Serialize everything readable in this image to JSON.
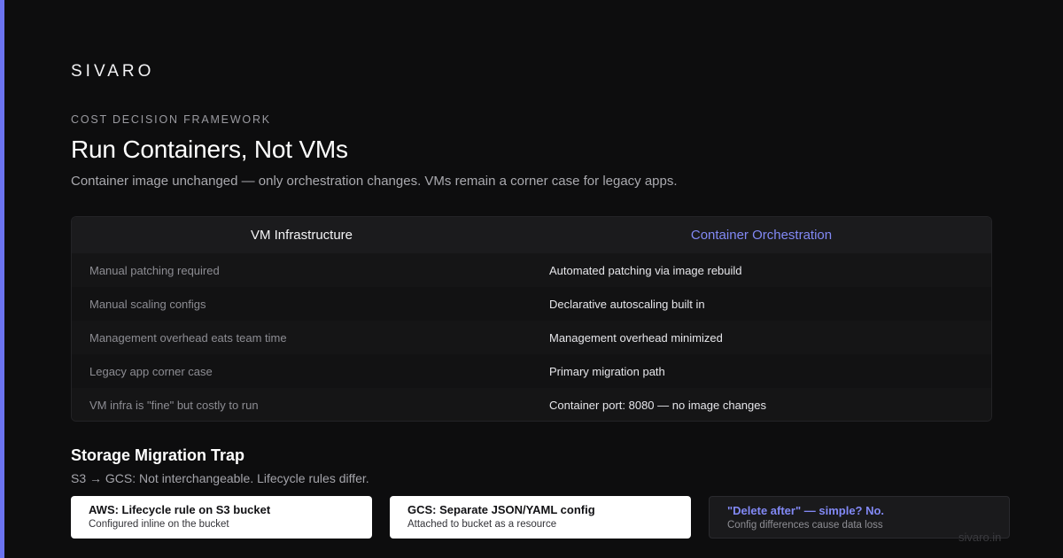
{
  "brand": "SIVARO",
  "eyebrow": "COST DECISION FRAMEWORK",
  "title": "Run Containers, Not VMs",
  "subtitle": "Container image unchanged — only orchestration changes. VMs remain a corner case for legacy apps.",
  "comparison": {
    "headers": {
      "left": "VM Infrastructure",
      "right": "Container Orchestration"
    },
    "rows": [
      {
        "left": "Manual patching required",
        "right": "Automated patching via image rebuild"
      },
      {
        "left": "Manual scaling configs",
        "right": "Declarative autoscaling built in"
      },
      {
        "left": "Management overhead eats team time",
        "right": "Management overhead minimized"
      },
      {
        "left": "Legacy app corner case",
        "right": "Primary migration path"
      },
      {
        "left": "VM infra is \"fine\" but costly to run",
        "right": "Container port: 8080 — no image changes"
      }
    ]
  },
  "storage": {
    "title": "Storage Migration Trap",
    "subtitle": "S3 → GCS: Not interchangeable. Lifecycle rules differ.",
    "cards": [
      {
        "title": "AWS: Lifecycle rule on S3 bucket",
        "sub": "Configured inline on the bucket"
      },
      {
        "title": "GCS: Separate JSON/YAML config",
        "sub": "Attached to bucket as a resource"
      },
      {
        "title": "\"Delete after\" — simple? No.",
        "sub": "Config differences cause data loss"
      }
    ]
  },
  "watermark": "sivaro.in",
  "colors": {
    "accent": "#6b73f0",
    "background": "#0d0d0e",
    "highlight": "#8289f5"
  }
}
